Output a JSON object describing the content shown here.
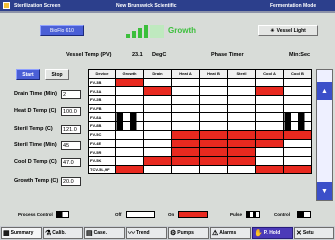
{
  "window": {
    "title_left": "Sterilization Screen",
    "title_center": "New Brunswick Scientific",
    "title_right": "Fermentation Mode"
  },
  "header": {
    "bioflo_button": "BioFlo 610",
    "growth_label": "Growth",
    "vessel_light_button": "Vessel Light"
  },
  "status": {
    "vessel_temp_label": "Vessel Temp (PV)",
    "vessel_temp_value": "23.1",
    "vessel_temp_unit": "DegC",
    "phase_timer_label": "Phase Timer",
    "phase_timer_unit": "Min:Sec"
  },
  "controls": {
    "start_label": "Start",
    "stop_label": "Stop"
  },
  "params": [
    {
      "label": "Drain Time (Min)",
      "value": "2"
    },
    {
      "label": "Heat D Temp (C)",
      "value": "100.0"
    },
    {
      "label": "Steril Temp (C)",
      "value": "121.0"
    },
    {
      "label": "Steril Time (Min)",
      "value": "45"
    },
    {
      "label": "Cool D Temp (C)",
      "value": "47.0"
    },
    {
      "label": "Growth Temp (C)",
      "value": "20.0"
    }
  ],
  "grid": {
    "columns": [
      "Device",
      "Growth",
      "Drain",
      "Heat A",
      "Heat B",
      "Steril",
      "Cool A",
      "Cool B"
    ],
    "rows": [
      {
        "device": "FV-3B",
        "cells": [
          "on",
          "off",
          "off",
          "off",
          "off",
          "off",
          "off"
        ]
      },
      {
        "device": "FV-3A",
        "cells": [
          "off",
          "on",
          "off",
          "off",
          "off",
          "on",
          "off"
        ]
      },
      {
        "device": "FV-2B",
        "cells": [
          "off",
          "off",
          "off",
          "off",
          "off",
          "off",
          "off"
        ]
      },
      {
        "device": "FV-FB",
        "cells": [
          "off",
          "off",
          "off",
          "off",
          "off",
          "off",
          "off"
        ]
      },
      {
        "device": "FV-8A",
        "cells": [
          "pulse",
          "off",
          "off",
          "off",
          "off",
          "off",
          "pulse"
        ]
      },
      {
        "device": "FV-8B",
        "cells": [
          "pulse",
          "off",
          "off",
          "off",
          "off",
          "off",
          "pulse"
        ]
      },
      {
        "device": "FV-5C",
        "cells": [
          "off",
          "off",
          "on",
          "on",
          "on",
          "on",
          "on"
        ]
      },
      {
        "device": "FV-4E",
        "cells": [
          "off",
          "off",
          "on",
          "on",
          "on",
          "on",
          "off"
        ]
      },
      {
        "device": "FV-5R",
        "cells": [
          "off",
          "off",
          "on",
          "on",
          "on",
          "off",
          "off"
        ]
      },
      {
        "device": "FV-5K",
        "cells": [
          "off",
          "on",
          "on",
          "on",
          "on",
          "off",
          "off"
        ]
      },
      {
        "device": "TCV-5L,9F",
        "cells": [
          "on",
          "off",
          "off",
          "off",
          "off",
          "on",
          "on"
        ]
      }
    ]
  },
  "legend": {
    "process_control": "Process Control",
    "off": "Off",
    "on": "On",
    "pulse": "Pulse",
    "control": "Control"
  },
  "tabs": [
    {
      "label": "Summary",
      "icon": "▦"
    },
    {
      "label": "Calib.",
      "icon": "⚗"
    },
    {
      "label": "Case.",
      "icon": "▤"
    },
    {
      "label": "Trend",
      "icon": "〰"
    },
    {
      "label": "Pumps",
      "icon": "⚙"
    },
    {
      "label": "Alarms",
      "icon": "⚠"
    },
    {
      "label": "P. Hold",
      "icon": "✋"
    },
    {
      "label": "Setu",
      "icon": "✕"
    }
  ],
  "colors": {
    "title_bg": "#2c3f8c",
    "accent_blue": "#4a5fd6",
    "on_red": "#e8291f",
    "growth_green": "#3cbf3c"
  }
}
